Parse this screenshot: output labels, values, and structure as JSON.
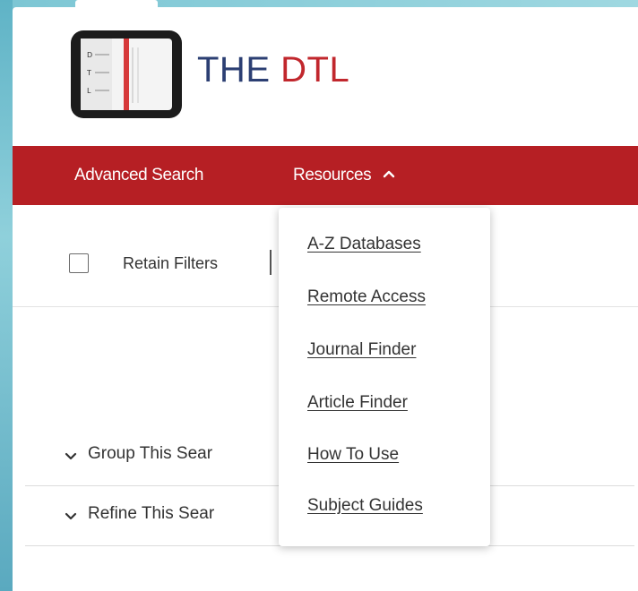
{
  "brand": {
    "part1": "THE",
    "part2": "DTL",
    "logo_letters": [
      "D",
      "T",
      "L"
    ]
  },
  "navbar": {
    "advanced_search": "Advanced Search",
    "resources": "Resources",
    "resources_icon": "chevron-up-icon"
  },
  "filters": {
    "retain_label": "Retain Filters",
    "checked": false
  },
  "sections": [
    {
      "label": "Group This Sear",
      "icon": "chevron-down-icon"
    },
    {
      "label": "Refine This Sear",
      "icon": "chevron-down-icon"
    }
  ],
  "resources_menu": {
    "items": [
      {
        "label": "A-Z Databases"
      },
      {
        "label": "Remote Access"
      },
      {
        "label": "Journal Finder"
      },
      {
        "label": "Article Finder"
      },
      {
        "label": "How To Use"
      },
      {
        "label": "Subject Guides"
      }
    ]
  },
  "colors": {
    "nav_red": "#b61f24",
    "brand_navy": "#2c3f73",
    "brand_red": "#c1272d",
    "background_teal": "#6fb9c9"
  }
}
